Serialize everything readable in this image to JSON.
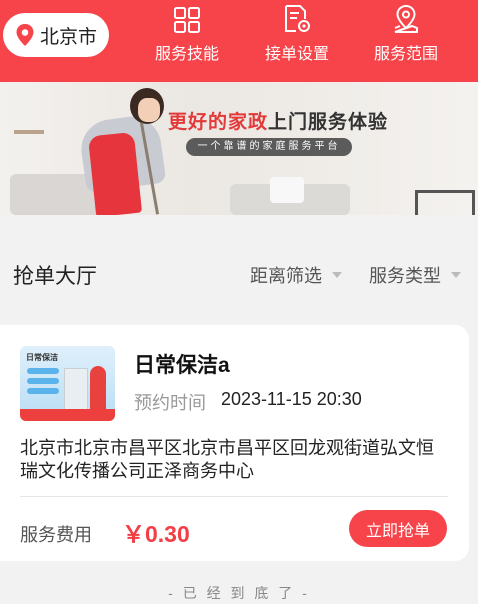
{
  "header": {
    "city": "北京市",
    "nav": [
      {
        "label": "服务技能",
        "icon": "grid-icon"
      },
      {
        "label": "接单设置",
        "icon": "document-gear-icon"
      },
      {
        "label": "服务范围",
        "icon": "map-pin-icon"
      }
    ]
  },
  "banner": {
    "title_highlight": "更好的家政",
    "title_rest": "上门服务体验",
    "subtitle": "一个靠谱的家庭服务平台"
  },
  "hall": {
    "title": "抢单大厅",
    "filters": [
      {
        "label": "距离筛选"
      },
      {
        "label": "服务类型"
      }
    ]
  },
  "order": {
    "thumb_title": "日常保洁",
    "title": "日常保洁a",
    "appt_label": "预约时间",
    "appt_value": "2023-11-15 20:30",
    "address": "北京市北京市昌平区北京市昌平区回龙观街道弘文恒瑞文化传播公司正泽商务中心",
    "fee_label": "服务费用",
    "fee_value": "￥0.30",
    "grab_label": "立即抢单"
  },
  "footer": {
    "end_text": "- 已 经 到 底 了 -"
  },
  "colors": {
    "brand_red": "#f6444a",
    "price_red": "#f33e44"
  }
}
